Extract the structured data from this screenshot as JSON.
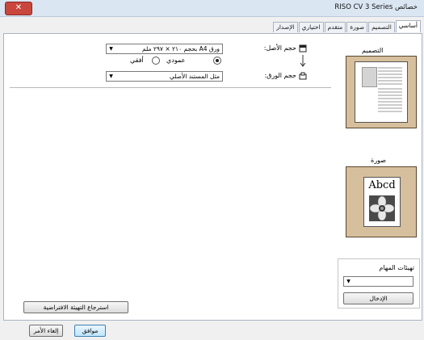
{
  "window": {
    "title": "خصائص RISO CV 3 Series",
    "close_label": "✕"
  },
  "tabs": [
    {
      "label": "أساسي",
      "active": true
    },
    {
      "label": "التصميم"
    },
    {
      "label": "صورة"
    },
    {
      "label": "متقدم"
    },
    {
      "label": "اختياري"
    },
    {
      "label": "الإصدار"
    }
  ],
  "basic": {
    "original_size_label": "حجم الأصل:",
    "original_size_value": "ورق A4 بحجم ٢١٠ × ٢٩٧ ملم",
    "orientation_portrait": "عمودي",
    "orientation_landscape": "أفقي",
    "orientation_selected": "portrait",
    "paper_size_label": "حجم الورق:",
    "paper_size_value": "مثل المستند الأصلي"
  },
  "preview": {
    "layout_title": "التصميم",
    "image_title": "صورة",
    "image_sample_text": "Abcd"
  },
  "presets": {
    "title": "تهيئات المهام",
    "select_value": "",
    "entry_button": "الإدخال"
  },
  "restore_defaults": "استرجاع التهيئة الافتراضية",
  "footer": {
    "ok": "موافق",
    "cancel": "إلغاء الأمر"
  },
  "colors": {
    "preview_frame": "#d6bf9c",
    "accent": "#dbe6f3"
  }
}
